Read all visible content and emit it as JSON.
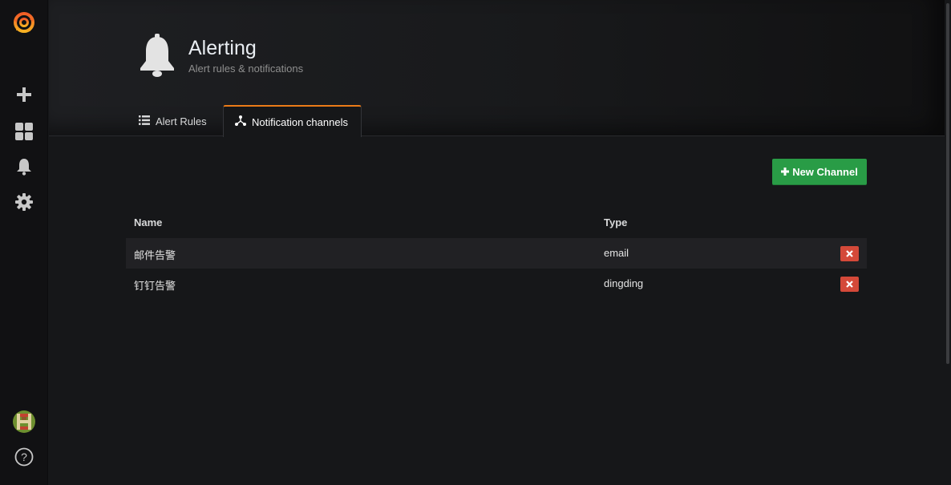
{
  "sidebar": {
    "logo": "grafana-logo-icon",
    "items": [
      {
        "name": "plus-icon",
        "label": "Create"
      },
      {
        "name": "dashboards-icon",
        "label": "Dashboards"
      },
      {
        "name": "bell-icon",
        "label": "Alerting"
      },
      {
        "name": "gear-icon",
        "label": "Configuration"
      }
    ],
    "bottom": [
      {
        "name": "user-avatar"
      },
      {
        "name": "help-icon"
      }
    ]
  },
  "header": {
    "icon": "bell-icon",
    "title": "Alerting",
    "subtitle": "Alert rules & notifications"
  },
  "tabs": [
    {
      "label": "Alert Rules",
      "icon": "list-icon",
      "active": false
    },
    {
      "label": "Notification channels",
      "icon": "channels-icon",
      "active": true
    }
  ],
  "actions": {
    "new_channel_label": "New Channel"
  },
  "table": {
    "columns": [
      "Name",
      "Type"
    ],
    "rows": [
      {
        "name": "邮件告警",
        "type": "email"
      },
      {
        "name": "钉钉告警",
        "type": "dingding"
      }
    ]
  },
  "colors": {
    "accent_tab": "#eb7b18",
    "primary_button": "#299c46",
    "danger_button": "#d44939",
    "background": "#161719"
  }
}
